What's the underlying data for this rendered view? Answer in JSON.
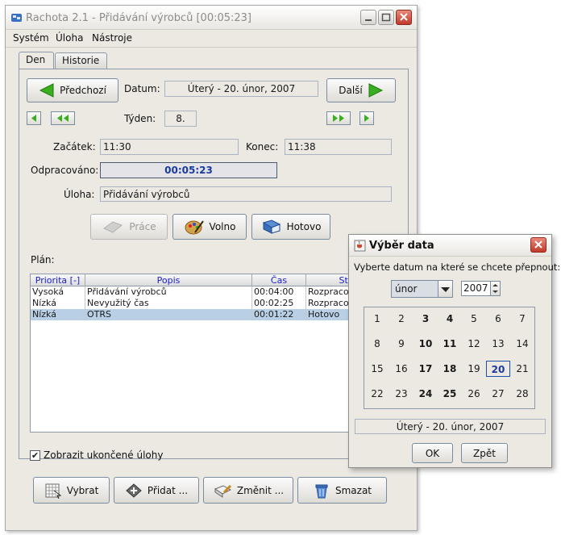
{
  "window": {
    "title": "Rachota 2.1 - Přidávání výrobců [00:05:23]"
  },
  "menu": [
    "Systém",
    "Úloha",
    "Nástroje"
  ],
  "tabs": [
    "Den",
    "Historie"
  ],
  "day": {
    "prev_label": "Předchozí",
    "next_label": "Další",
    "date_label": "Datum:",
    "date_value": "Úterý - 20. únor, 2007",
    "week_label": "Týden:",
    "week_value": "8.",
    "start_label": "Začátek:",
    "start_value": "11:30",
    "end_label": "Konec:",
    "end_value": "11:38",
    "worked_label": "Odpracováno:",
    "worked_value": "00:05:23",
    "task_label": "Úloha:",
    "task_value": "Přidávání výrobců",
    "work_btn": "Práce",
    "free_btn": "Volno",
    "done_btn": "Hotovo",
    "plan_label": "Plán:",
    "show_finished_label": "Zobrazit ukončené úlohy",
    "select_btn": "Vybrat",
    "add_btn": "Přidat ...",
    "change_btn": "Změnit ...",
    "delete_btn": "Smazat"
  },
  "table": {
    "headers": [
      "Priorita [-]",
      "Popis",
      "Čas",
      "Sta"
    ],
    "rows": [
      [
        "Vysoká",
        "Přidávání výrobců",
        "00:04:00",
        "Rozpraco"
      ],
      [
        "Nízká",
        "Nevyužitý čas",
        "00:02:25",
        "Rozpraco"
      ],
      [
        "Nízká",
        "OTRS",
        "00:01:22",
        "Hotovo"
      ]
    ]
  },
  "dialog": {
    "title": "Výběr data",
    "prompt": "Vyberte datum na které se chcete přepnout:",
    "month": "únor",
    "year": "2007",
    "weeks": [
      [
        "1",
        "2",
        "3",
        "4",
        "5",
        "6",
        "7"
      ],
      [
        "8",
        "9",
        "10",
        "11",
        "12",
        "13",
        "14"
      ],
      [
        "15",
        "16",
        "17",
        "18",
        "19",
        "20",
        "21"
      ],
      [
        "22",
        "23",
        "24",
        "25",
        "26",
        "27",
        "28"
      ]
    ],
    "bold_days": [
      "3",
      "4",
      "10",
      "11",
      "17",
      "18",
      "24",
      "25"
    ],
    "selected_day": "20",
    "selected_date": "Úterý - 20. únor, 2007",
    "ok_label": "OK",
    "back_label": "Zpět"
  },
  "colors": {
    "window_bg": "#ece9e3",
    "selection": "#b8cfe5",
    "header_text": "#1a22c7",
    "nav_arrow": "#3aae1f",
    "close_button": "#c0392b"
  }
}
